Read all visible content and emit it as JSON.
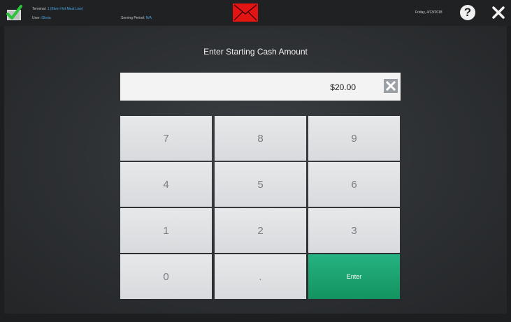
{
  "header": {
    "terminal_label": "Terminal:",
    "terminal_value": "1 (Elem Hot Meal Line)",
    "user_label": "User:",
    "user_value": "Gloria",
    "serving_label": "Serving Period:",
    "serving_value": "N/A",
    "date": "Friday, 4/13/2018",
    "help_glyph": "?",
    "mail_color": "#e31414"
  },
  "main": {
    "prompt": "Enter Starting Cash Amount",
    "amount": "$20.00"
  },
  "keypad": {
    "keys": [
      "7",
      "8",
      "9",
      "4",
      "5",
      "6",
      "1",
      "2",
      "3",
      "0",
      ".",
      "Enter"
    ],
    "enter_color": "#16a06c"
  }
}
